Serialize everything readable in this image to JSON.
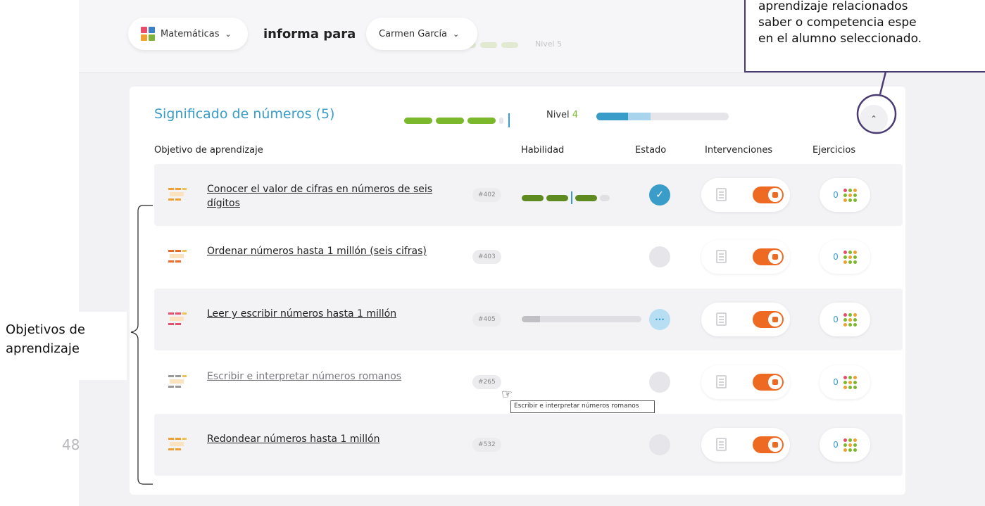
{
  "topbar": {
    "subject": "Matemáticas",
    "informa": "informa para",
    "student": "Carmen García",
    "ghost_level": "Nivel 5"
  },
  "card": {
    "title": "Significado de números",
    "count": "(5)",
    "level_label": "Nivel",
    "level_value": "4",
    "level_segments_filled": 3,
    "progress_primary": 0.24,
    "progress_secondary": 0.41,
    "headers": {
      "objetivo": "Objetivo de aprendizaje",
      "habilidad": "Habilidad",
      "estado": "Estado",
      "intervenciones": "Intervenciones",
      "ejercicios": "Ejercicios"
    }
  },
  "rows": [
    {
      "name_line1": "Conocer el valor de cifras en números de seis",
      "name_line2": "dígitos",
      "code": "#402",
      "skill": "segments",
      "estado": "done",
      "ejercicios": "0",
      "muted": false,
      "shade": true
    },
    {
      "name_line1": "Ordenar números hasta 1 millón (seis cifras)",
      "name_line2": "",
      "code": "#403",
      "skill": "none",
      "estado": "empty",
      "ejercicios": "0",
      "muted": false,
      "shade": false
    },
    {
      "name_line1": "Leer y escribir números hasta 1 millón",
      "name_line2": "",
      "code": "#405",
      "skill": "bar",
      "skill_fill": 0.15,
      "estado": "progress",
      "ejercicios": "0",
      "muted": false,
      "shade": true
    },
    {
      "name_line1": "Escribir e interpretar números romanos",
      "name_line2": "",
      "code": "#265",
      "skill": "none",
      "estado": "empty",
      "ejercicios": "0",
      "muted": true,
      "shade": false
    },
    {
      "name_line1": "Redondear números hasta 1 millón",
      "name_line2": "",
      "code": "#532",
      "skill": "none",
      "estado": "empty",
      "ejercicios": "0",
      "muted": false,
      "shade": true
    }
  ],
  "tooltip": "Escribir e interpretar números romanos",
  "annotations": {
    "top_lines": [
      "aprendizaje relacionados",
      "saber o competencia espe",
      "en el alumno seleccionado."
    ],
    "side_lines": [
      "Objetivos de",
      "aprendizaje"
    ],
    "page_number": "48"
  },
  "colors": {
    "accent_blue": "#3a9cc8",
    "level_green": "#7cb82c",
    "skill_green": "#5f8a1f",
    "toggle_orange": "#ee6a22",
    "annotation_purple": "#4a3b72"
  }
}
